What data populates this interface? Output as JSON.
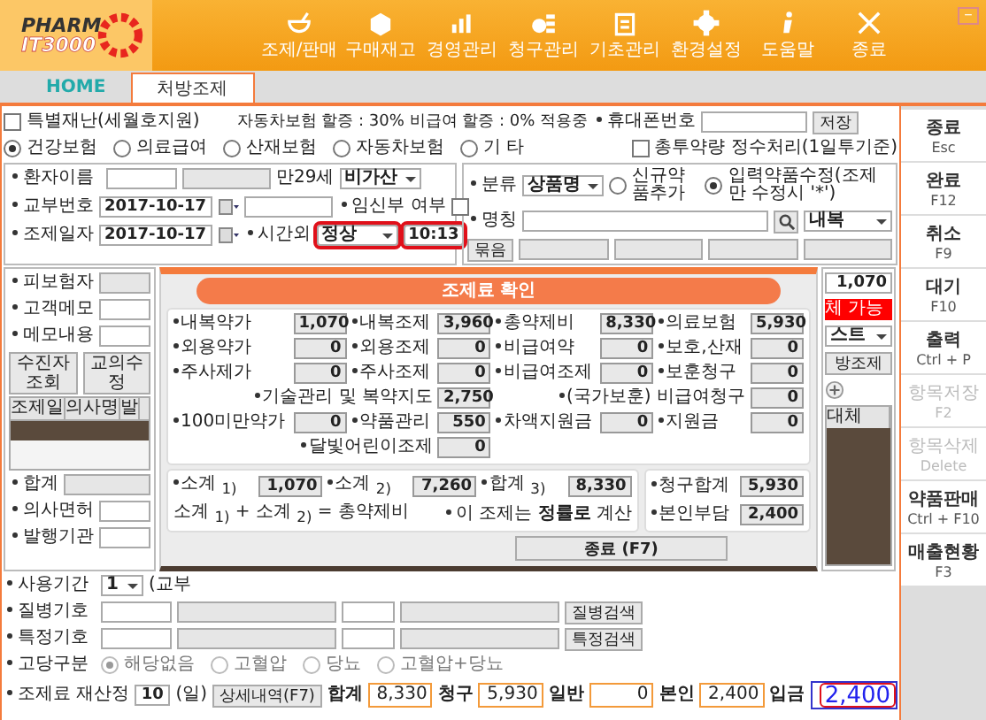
{
  "header": {
    "logo_top": "PHARM",
    "logo_bottom": "IT3000",
    "minimize": "−",
    "nav": [
      {
        "label": "조제/판매",
        "kind": "mortar"
      },
      {
        "label": "구매재고",
        "kind": "box"
      },
      {
        "label": "경영관리",
        "kind": "chart"
      },
      {
        "label": "청구관리",
        "kind": "coins"
      },
      {
        "label": "기초관리",
        "kind": "clipboard"
      },
      {
        "label": "환경설정",
        "kind": "gear"
      },
      {
        "label": "도움말",
        "kind": "info"
      },
      {
        "label": "종료",
        "kind": "close"
      }
    ]
  },
  "tabs": [
    {
      "label": "HOME",
      "selected": false
    },
    {
      "label": "처방조제",
      "selected": true
    }
  ],
  "form": {
    "special_disaster": {
      "label": "특별재난(세월호지원)",
      "checked": false
    },
    "surcharge_note": "자동차보험 할증 : 30% 비급여 할증 : 0% 적용중",
    "phone_label": "휴대폰번호",
    "save_button": "저장",
    "insurance_types": [
      {
        "label": "건강보험",
        "selected": true
      },
      {
        "label": "의료급여",
        "selected": false
      },
      {
        "label": "산재보험",
        "selected": false
      },
      {
        "label": "자동차보험",
        "selected": false
      },
      {
        "label": "기 타",
        "selected": false
      }
    ],
    "round_total": {
      "label": "총투약량 정수처리(1일투기준)",
      "checked": false
    },
    "patient": {
      "name_label": "환자이름",
      "age": "만29세",
      "surcharge": "비가산",
      "issue_label": "교부번호",
      "issue_date": "2017-10-17",
      "pregnant": {
        "label": "임신부 여부",
        "checked": false
      },
      "dispense_label": "조제일자",
      "dispense_date": "2017-10-17",
      "after_hours_label": "시간외",
      "after_hours": "정상",
      "time": "10:13"
    },
    "drug": {
      "class_label": "분류",
      "class_value": "상품명",
      "options": [
        {
          "label": "신규약품추가",
          "selected": false
        },
        {
          "label": "입력약품수정(조제만 수정시 '*')",
          "selected": true
        }
      ],
      "name_label": "명칭",
      "route": "내복",
      "bundle_button": "묶음",
      "amount": "1,070",
      "substitute_badge": "체 가능",
      "list_select": "스트",
      "side_button": "방조제",
      "column": "대체"
    },
    "left": {
      "insured_label": "피보험자",
      "memo_label": "고객메모",
      "memo_content_label": "메모내용",
      "buttons": [
        "수진자조회",
        "교의수정"
      ],
      "columns": [
        "조제일",
        "의사명",
        "발"
      ],
      "rows": [
        {
          "selected": true
        }
      ],
      "total_label": "합계",
      "license_label": "의사면허",
      "issuer_label": "발행기관",
      "period_label": "사용기간",
      "period": "1",
      "period_note": "(교부"
    },
    "codes": [
      {
        "label": "질병기호",
        "button": "질병검색"
      },
      {
        "label": "특정기호",
        "button": "특정검색"
      }
    ],
    "chronic": {
      "label": "고당구분",
      "options": [
        {
          "label": "해당없음",
          "selected": true
        },
        {
          "label": "고혈압",
          "selected": false
        },
        {
          "label": "당뇨",
          "selected": false
        },
        {
          "label": "고혈압+당뇨",
          "selected": false
        }
      ]
    },
    "bottom": {
      "recalc_label": "조제료 재산정",
      "days": "10",
      "days_unit": "(일)",
      "detail_button": "상세내역(F7)",
      "totals": [
        {
          "label": "합계",
          "value": "8,330"
        },
        {
          "label": "청구",
          "value": "5,930"
        },
        {
          "label": "일반",
          "value": "0"
        },
        {
          "label": "본인",
          "value": "2,400"
        }
      ],
      "deposit_label": "입금",
      "deposit": "2,400"
    }
  },
  "modal": {
    "title": "조제료 확인",
    "rows": [
      [
        {
          "label": "내복약가",
          "value": "1,070"
        },
        {
          "label": "내복조제",
          "value": "3,960"
        },
        {
          "label": "총약제비",
          "value": "8,330"
        },
        {
          "label": "의료보험",
          "value": "5,930"
        }
      ],
      [
        {
          "label": "외용약가",
          "value": "0"
        },
        {
          "label": "외용조제",
          "value": "0"
        },
        {
          "label": "비급여약",
          "value": "0"
        },
        {
          "label": "보호,산재",
          "value": "0"
        }
      ],
      [
        {
          "label": "주사제가",
          "value": "0"
        },
        {
          "label": "주사조제",
          "value": "0"
        },
        {
          "label": "비급여조제",
          "value": "0"
        },
        {
          "label": "보훈청구",
          "value": "0"
        }
      ],
      [
        "",
        {
          "label": "기술관리 및 복약지도",
          "value": "2,750"
        },
        "",
        {
          "label": "(국가보훈) 비급여청구",
          "value": "0"
        }
      ],
      [
        {
          "label": "100미만약가",
          "value": "0"
        },
        {
          "label": "약품관리",
          "value": "550"
        },
        {
          "label": "차액지원금",
          "value": "0"
        },
        {
          "label": "지원금",
          "value": "0"
        }
      ],
      [
        "",
        {
          "label": "달빛어린이조제",
          "value": "0"
        }
      ]
    ],
    "subtotals": [
      {
        "label": "소계 $_{1)}$",
        "value": "1,070"
      },
      {
        "label": "소계 $_{2)}$",
        "value": "7,260"
      },
      {
        "label": "합계 $_{3)}$",
        "value": "8,330"
      }
    ],
    "claim_total": {
      "label": "청구합계",
      "value": "5,930"
    },
    "formula": "소계 $_{1)}$ + 소계 $_{2)}$ = 총약제비",
    "method": {
      "prefix": "이 조제는",
      "value": "정률로",
      "suffix": "계산"
    },
    "copay": {
      "label": "본인부담",
      "value": "2,400"
    },
    "close_button": "종료 (F7)"
  },
  "sidebar": [
    {
      "label": "종료",
      "key": "Esc",
      "disabled": false
    },
    {
      "label": "완료",
      "key": "F12",
      "disabled": false
    },
    {
      "label": "취소",
      "key": "F9",
      "disabled": false
    },
    {
      "label": "대기",
      "key": "F10",
      "disabled": false
    },
    {
      "label": "출력",
      "key": "Ctrl + P",
      "disabled": false
    },
    {
      "label": "항목저장",
      "key": "F2",
      "disabled": true
    },
    {
      "label": "항목삭제",
      "key": "Delete",
      "disabled": true
    },
    {
      "label": "약품판매",
      "key": "Ctrl + F10",
      "disabled": false
    },
    {
      "label": "매출현황",
      "key": "F3",
      "disabled": false
    }
  ]
}
